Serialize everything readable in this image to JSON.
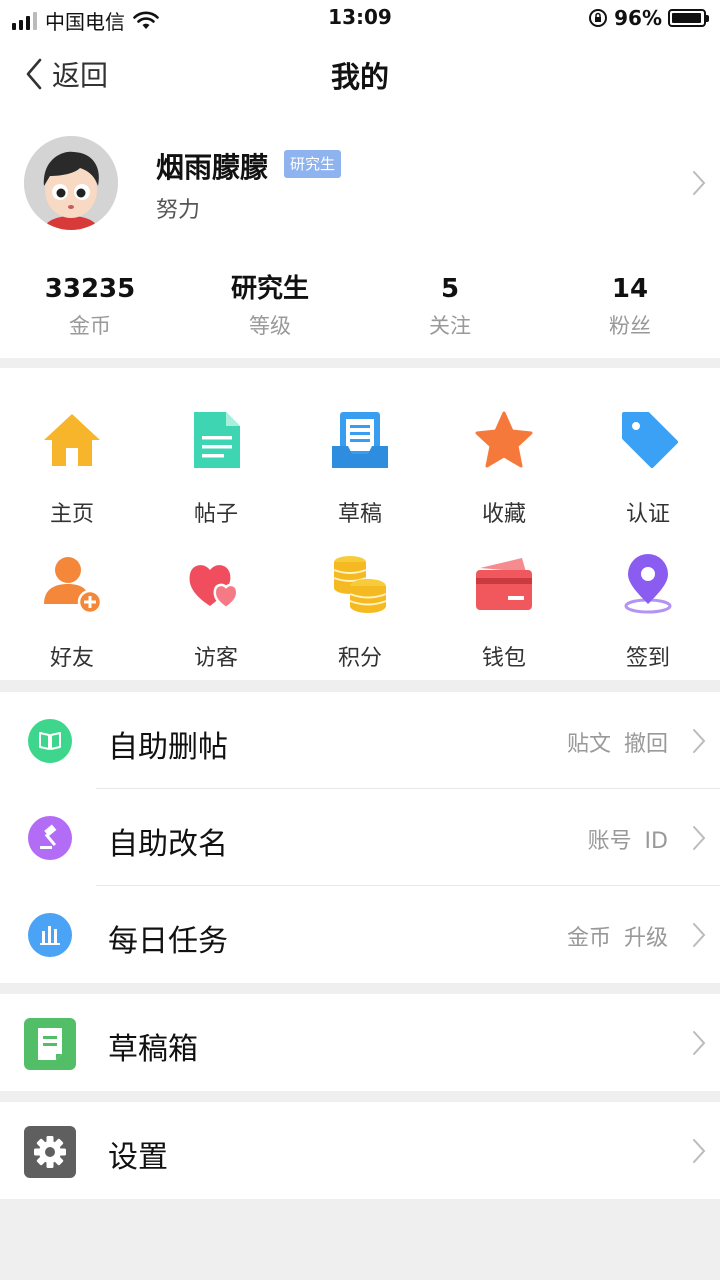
{
  "status_bar": {
    "carrier": "中国电信",
    "time": "13:09",
    "battery": "96%",
    "battery_level": 0.96
  },
  "nav": {
    "back_label": "返回",
    "title": "我的"
  },
  "profile": {
    "name": "烟雨朦朦",
    "level_badge": "研究生",
    "motto": "努力",
    "stats": [
      {
        "value": "33235",
        "label": "金币"
      },
      {
        "value": "研究生",
        "label": "等级"
      },
      {
        "value": "5",
        "label": "关注"
      },
      {
        "value": "14",
        "label": "粉丝"
      }
    ]
  },
  "grid": {
    "row1": [
      {
        "label": "主页",
        "icon": "home-icon",
        "color": "#f7b52c"
      },
      {
        "label": "帖子",
        "icon": "document-icon",
        "color": "#3ed6b2"
      },
      {
        "label": "草稿",
        "icon": "draft-tray-icon",
        "color": "#3a9ef0"
      },
      {
        "label": "收藏",
        "icon": "star-icon",
        "color": "#f5793a"
      },
      {
        "label": "认证",
        "icon": "tag-icon",
        "color": "#3aa1f5"
      }
    ],
    "row2": [
      {
        "label": "好友",
        "icon": "add-friend-icon",
        "color": "#f5873a"
      },
      {
        "label": "访客",
        "icon": "hearts-icon",
        "color": "#f04e5e"
      },
      {
        "label": "积分",
        "icon": "coins-icon",
        "color": "#f5c12f"
      },
      {
        "label": "钱包",
        "icon": "wallet-card-icon",
        "color": "#f0585e"
      },
      {
        "label": "签到",
        "icon": "location-pin-icon",
        "color": "#8a5cf0"
      }
    ]
  },
  "menu": {
    "items": [
      {
        "label": "自助删帖",
        "hint": "贴文 撤回",
        "icon": "book-icon",
        "color": "#3dd68c"
      },
      {
        "label": "自助改名",
        "hint": "账号 ID",
        "icon": "gavel-icon",
        "color": "#b36cf5"
      },
      {
        "label": "每日任务",
        "hint": "金币 升级",
        "icon": "bar-chart-icon",
        "color": "#4aa3f5"
      }
    ],
    "drafts": {
      "label": "草稿箱",
      "icon": "draft-box-icon",
      "color": "#52bf68"
    },
    "settings": {
      "label": "设置",
      "icon": "gear-icon",
      "color": "#5f5f5f"
    }
  }
}
